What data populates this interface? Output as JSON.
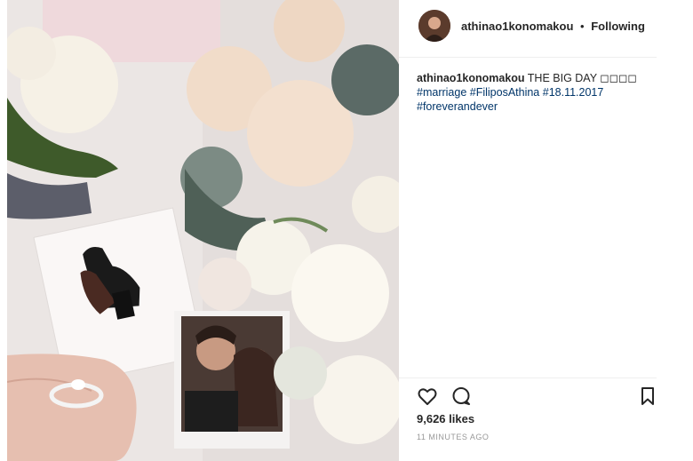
{
  "post": {
    "username": "athinao1konomakou",
    "separator": "•",
    "follow_status": "Following",
    "caption_username": "athinao1konomakou",
    "caption_text": "THE BIG DAY ◻◻◻◻",
    "hashtags_line1": "#marriage #FiliposAthina",
    "hashtag_date": "#18.11.2017",
    "hashtags_line2": "#foreverandever",
    "likes": "9,626 likes",
    "timestamp": "11 MINUTES AGO"
  },
  "icons": {
    "like": "heart-icon",
    "comment": "comment-icon",
    "save": "bookmark-icon"
  },
  "colors": {
    "hashtag": "#003569",
    "text": "#262626",
    "muted": "#999999"
  }
}
